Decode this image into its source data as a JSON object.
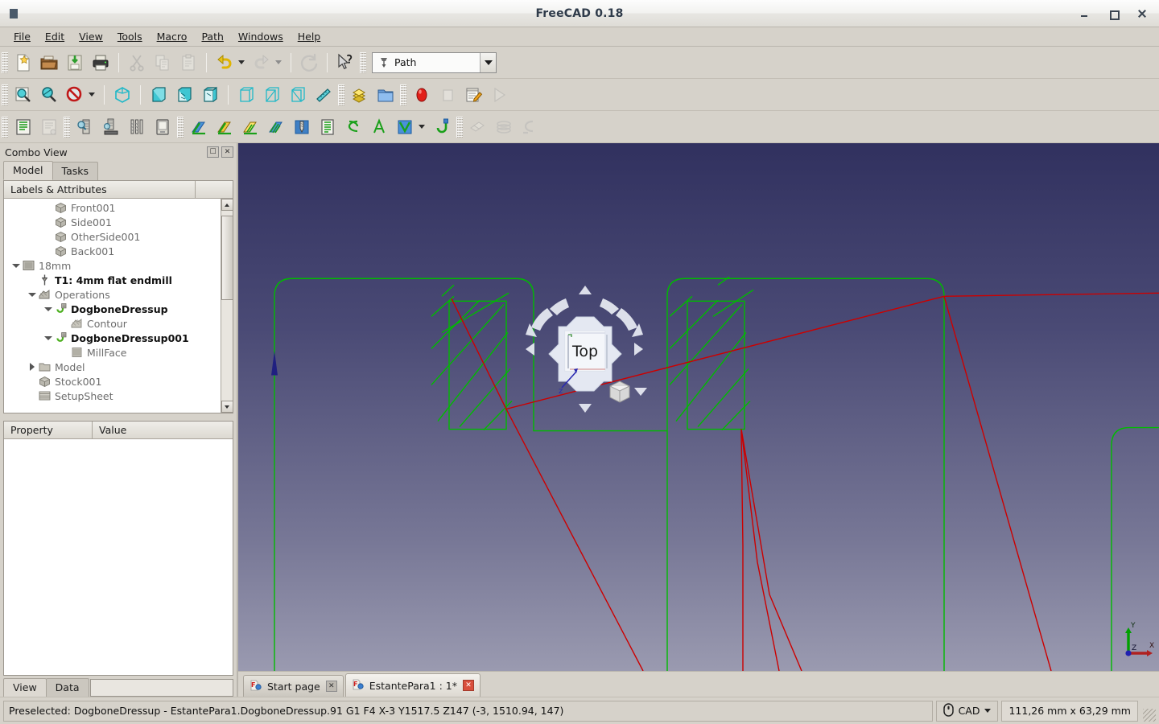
{
  "window": {
    "title": "FreeCAD 0.18",
    "buttons": {
      "minimize": "minimize",
      "maximize": "maximize",
      "close": "close"
    }
  },
  "menubar": {
    "items": [
      {
        "label": "File"
      },
      {
        "label": "Edit"
      },
      {
        "label": "View"
      },
      {
        "label": "Tools"
      },
      {
        "label": "Macro"
      },
      {
        "label": "Path"
      },
      {
        "label": "Windows"
      },
      {
        "label": "Help"
      }
    ]
  },
  "toolbars": {
    "file": [
      {
        "name": "new-document-button",
        "icon": "new-file-icon",
        "enabled": true
      },
      {
        "name": "open-document-button",
        "icon": "open-folder-icon",
        "enabled": true
      },
      {
        "name": "save-document-button",
        "icon": "save-icon",
        "enabled": true
      },
      {
        "name": "print-document-button",
        "icon": "printer-icon",
        "enabled": true
      },
      {
        "name": "cut-button",
        "icon": "scissors-icon",
        "enabled": false
      },
      {
        "name": "copy-button",
        "icon": "copy-icon",
        "enabled": false
      },
      {
        "name": "paste-button",
        "icon": "clipboard-icon",
        "enabled": false
      },
      {
        "name": "undo-button",
        "icon": "undo-arrow-icon",
        "enabled": true
      },
      {
        "name": "redo-button",
        "icon": "redo-arrow-icon",
        "enabled": false
      },
      {
        "name": "refresh-button",
        "icon": "refresh-icon",
        "enabled": false
      },
      {
        "name": "whats-this-button",
        "icon": "cursor-question-icon",
        "enabled": true
      }
    ],
    "workbench": {
      "name": "workbench-selector",
      "label": "Path",
      "icon": "path-workbench-icon"
    },
    "view": [
      {
        "name": "fit-all-button",
        "icon": "fit-all-icon",
        "enabled": true
      },
      {
        "name": "fit-selection-button",
        "icon": "fit-selection-icon",
        "enabled": true
      },
      {
        "name": "draw-style-button",
        "icon": "draw-style-icon",
        "enabled": true
      },
      {
        "name": "axonometric-view-button",
        "icon": "isometric-view-icon",
        "enabled": true
      },
      {
        "name": "front-view-button",
        "icon": "front-view-icon",
        "enabled": true
      },
      {
        "name": "top-view-button",
        "icon": "top-view-icon",
        "enabled": true
      },
      {
        "name": "right-view-button",
        "icon": "right-view-icon",
        "enabled": true
      },
      {
        "name": "rear-view-button",
        "icon": "rear-view-icon",
        "enabled": true
      },
      {
        "name": "bottom-view-button",
        "icon": "bottom-view-icon",
        "enabled": true
      },
      {
        "name": "left-view-button",
        "icon": "left-view-icon",
        "enabled": true
      },
      {
        "name": "measure-button",
        "icon": "ruler-icon",
        "enabled": true
      },
      {
        "name": "workbench-part-button",
        "icon": "yellow-layers-icon",
        "enabled": true
      },
      {
        "name": "create-group-button",
        "icon": "blue-folder-icon",
        "enabled": true
      },
      {
        "name": "macro-record-button",
        "icon": "record-dot-icon",
        "enabled": true
      },
      {
        "name": "macro-stop-button",
        "icon": "stop-square-icon",
        "enabled": false
      },
      {
        "name": "macro-edit-button",
        "icon": "macro-edit-icon",
        "enabled": true
      },
      {
        "name": "macro-execute-button",
        "icon": "play-triangle-icon",
        "enabled": false
      }
    ],
    "path_main": [
      {
        "name": "path-job-button",
        "icon": "job-icon",
        "enabled": true
      },
      {
        "name": "path-post-process-button",
        "icon": "post-process-icon",
        "enabled": false
      },
      {
        "name": "path-tool-inspect-button",
        "icon": "tool-inspect-icon",
        "enabled": true
      },
      {
        "name": "path-tool-library-button",
        "icon": "tool-library-icon",
        "enabled": true
      },
      {
        "name": "path-tool-bit-button",
        "icon": "drill-bits-icon",
        "enabled": true
      },
      {
        "name": "path-simulator-button",
        "icon": "simulator-icon",
        "enabled": true
      },
      {
        "name": "path-profile-button",
        "icon": "profile-op-icon",
        "enabled": true
      },
      {
        "name": "path-pocket-shape-button",
        "icon": "pocket-shape-op-icon",
        "enabled": true
      },
      {
        "name": "path-face-button",
        "icon": "face-op-icon",
        "enabled": true
      },
      {
        "name": "path-surface-button",
        "icon": "surface-op-icon",
        "enabled": true
      },
      {
        "name": "path-drilling-button",
        "icon": "drilling-op-icon",
        "enabled": true
      },
      {
        "name": "path-engrave-button",
        "icon": "engrave-op-icon",
        "enabled": true
      },
      {
        "name": "path-helix-button",
        "icon": "helix-op-icon",
        "enabled": true
      },
      {
        "name": "path-adaptive-button",
        "icon": "adaptive-op-icon",
        "enabled": true
      },
      {
        "name": "path-slot-button",
        "icon": "slot-op-icon",
        "enabled": true
      },
      {
        "name": "path-dressup-button",
        "icon": "dressup-icon",
        "enabled": true
      },
      {
        "name": "path-array-button",
        "icon": "array-icon",
        "enabled": false
      },
      {
        "name": "path-copy-button",
        "icon": "path-copy-icon",
        "enabled": false
      },
      {
        "name": "path-shape-button",
        "icon": "path-shape-icon",
        "enabled": false
      }
    ]
  },
  "combo_view": {
    "title": "Combo View",
    "float_button": "float",
    "close_button": "close",
    "tabs": [
      {
        "label": "Model",
        "active": true
      },
      {
        "label": "Tasks",
        "active": false
      }
    ],
    "tree": {
      "header": "Labels & Attributes",
      "nodes": [
        {
          "label": "Front001",
          "indent": 3,
          "twist": "none",
          "icon": "solid-box-icon",
          "style": "grey"
        },
        {
          "label": "Side001",
          "indent": 3,
          "twist": "none",
          "icon": "solid-box-icon",
          "style": "grey"
        },
        {
          "label": "OtherSide001",
          "indent": 3,
          "twist": "none",
          "icon": "solid-box-icon",
          "style": "grey"
        },
        {
          "label": "Back001",
          "indent": 3,
          "twist": "none",
          "icon": "solid-box-icon",
          "style": "grey"
        },
        {
          "label": "18mm",
          "indent": 1,
          "twist": "expanded",
          "icon": "tool-bit-icon",
          "style": "grey"
        },
        {
          "label": "T1: 4mm flat endmill",
          "indent": 2,
          "twist": "none",
          "icon": "endmill-icon",
          "style": "bold"
        },
        {
          "label": "Operations",
          "indent": 2,
          "twist": "expanded",
          "icon": "operations-icon",
          "style": "grey"
        },
        {
          "label": "DogboneDressup",
          "indent": 3,
          "twist": "expanded",
          "icon": "dogbone-icon",
          "style": "bold"
        },
        {
          "label": "Contour",
          "indent": 4,
          "twist": "none",
          "icon": "contour-icon",
          "style": "grey"
        },
        {
          "label": "DogboneDressup001",
          "indent": 3,
          "twist": "expanded",
          "icon": "dogbone-icon",
          "style": "bold"
        },
        {
          "label": "MillFace",
          "indent": 4,
          "twist": "none",
          "icon": "millface-icon",
          "style": "grey"
        },
        {
          "label": "Model",
          "indent": 2,
          "twist": "collapsed",
          "icon": "folder-icon",
          "style": "grey"
        },
        {
          "label": "Stock001",
          "indent": 2,
          "twist": "none",
          "icon": "solid-box-icon",
          "style": "grey"
        },
        {
          "label": "SetupSheet",
          "indent": 2,
          "twist": "none",
          "icon": "setupsheet-icon",
          "style": "grey"
        }
      ]
    },
    "property_editor": {
      "columns": [
        "Property",
        "Value"
      ],
      "rows": []
    },
    "bottom_tabs": [
      {
        "label": "View",
        "active": true
      },
      {
        "label": "Data",
        "active": false
      }
    ]
  },
  "viewport": {
    "nav_cube": {
      "face_label": "Top",
      "arrow_up": "rotate-up-arrow",
      "arrow_down": "rotate-down-arrow",
      "arrow_left": "rotate-left-arrow",
      "arrow_right": "rotate-right-arrow",
      "arc_left": "rotate-ccw-arc",
      "arc_right": "rotate-cw-arc",
      "corner_cube": "view-cube-icon",
      "corner_menu": "view-menu-chevron"
    },
    "axis_indicator": {
      "x": "X",
      "y": "Y",
      "z": "Z"
    },
    "colors": {
      "background_top": "#31315f",
      "background_bottom": "#9a9ab0",
      "toolpath_cut": "#00bb00",
      "toolpath_rapid": "#cc0000",
      "axis_x": "#b02020",
      "axis_y": "#00a000",
      "axis_z": "#2020b0",
      "marker": "#202080"
    }
  },
  "document_tabs": [
    {
      "label": "Start page",
      "icon": "freecad-doc-icon",
      "active": false,
      "close": "close-tab"
    },
    {
      "label": "EstantePara1 : 1*",
      "icon": "freecad-doc-icon",
      "active": true,
      "close": "close-tab"
    }
  ],
  "statusbar": {
    "message": "Preselected: DogboneDressup - EstantePara1.DogboneDressup.91 G1 F4 X-3 Y1517.5 Z147 (-3, 1510.94, 147)",
    "navigation_style": "CAD",
    "navigation_icon": "mouse-icon",
    "dimensions": "111,26 mm x 63,29 mm"
  }
}
